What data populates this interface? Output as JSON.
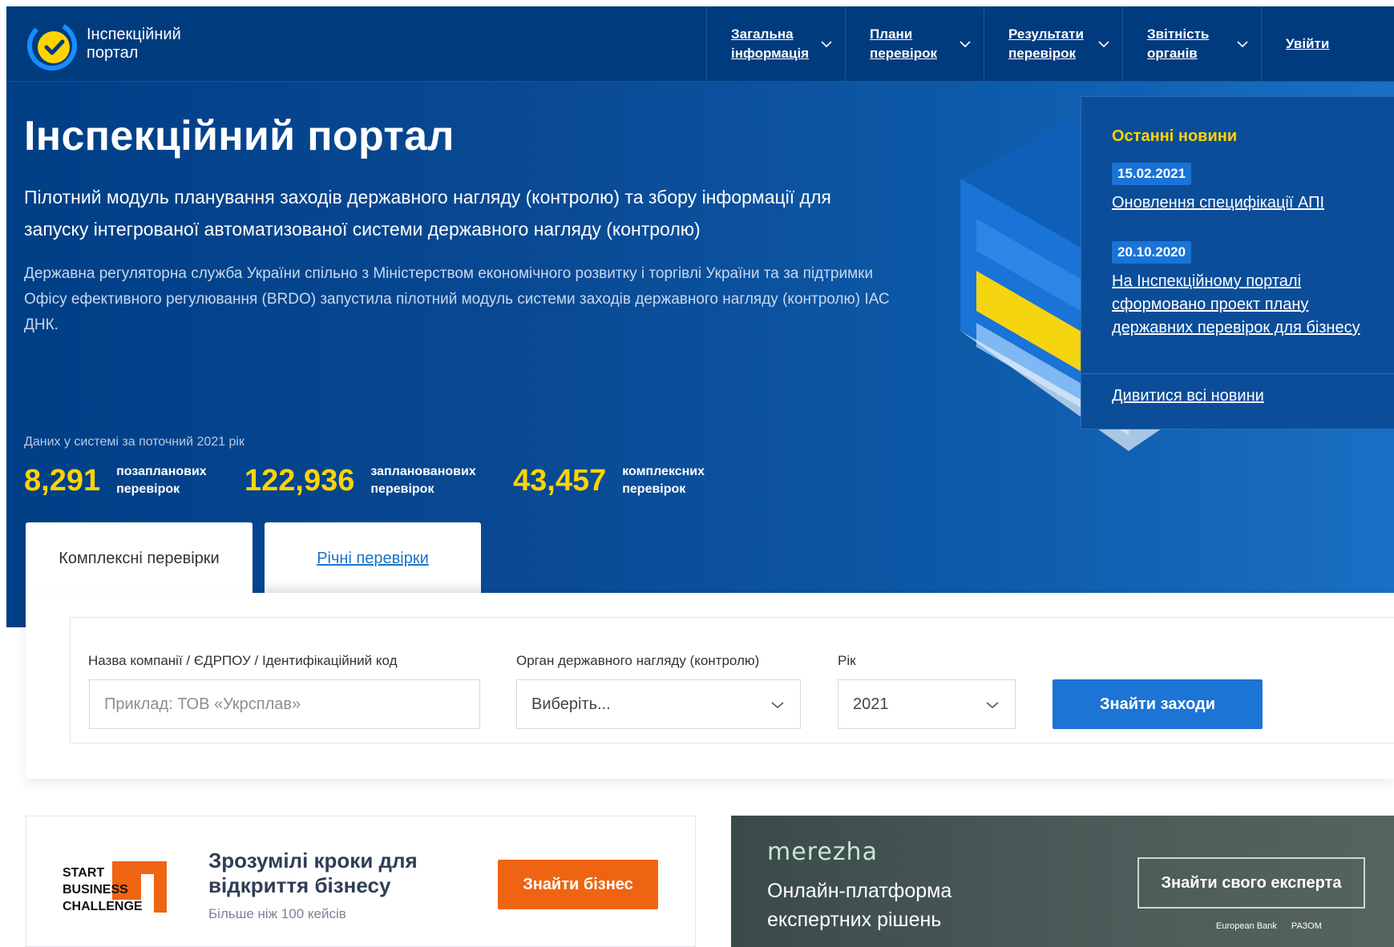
{
  "header": {
    "logo_line1": "Інспекційний",
    "logo_line2": "портал",
    "nav": [
      {
        "label": "Загальна інформація"
      },
      {
        "label": "Плани перевірок"
      },
      {
        "label": "Результати перевірок"
      },
      {
        "label": "Звітність органів"
      }
    ],
    "login": "Увійти"
  },
  "hero": {
    "title": "Інспекційний портал",
    "lead": "Пілотний модуль планування заходів державного нагляду (контролю) та збору інформації для запуску інтегрованої автоматизованої системи державного нагляду (контролю)",
    "description": "Державна регуляторна служба України спільно з Міністерством економічного розвитку і торгівлі України та за підтримки Офісу ефективного регулювання (BRDO) запустила пілотний модуль системи заходів державного нагляду (контролю) ІАС ДНК.",
    "stats_label": "Даних у системі за поточний 2021 рік",
    "stats": [
      {
        "value": "8,291",
        "caption_1": "позапланових",
        "caption_2": "перевірок"
      },
      {
        "value": "122,936",
        "caption_1": "запланованових",
        "caption_2": "перевірок"
      },
      {
        "value": "43,457",
        "caption_1": "комплексних",
        "caption_2": "перевірок"
      }
    ]
  },
  "tabs": {
    "active": "Комплексні перевірки",
    "inactive": "Річні перевірки"
  },
  "news": {
    "title": "Останні новини",
    "items": [
      {
        "date": "15.02.2021",
        "text": "Оновлення специфікації АПІ"
      },
      {
        "date": "20.10.2020",
        "text": "На Інспекційному порталі сформовано проект плану державних перевірок для бізнесу"
      }
    ],
    "all_link": "Дивитися всі новини"
  },
  "search": {
    "company_label": "Назва компанії / ЄДРПОУ / Ідентифікаційний код",
    "company_placeholder": "Приклад: ТОВ «Укрсплав»",
    "organ_label": "Орган державного нагляду (контролю)",
    "organ_value": "Виберіть...",
    "year_label": "Рік",
    "year_value": "2021",
    "submit": "Знайти заходи"
  },
  "banner_business": {
    "logo_line1": "START",
    "logo_line2": "BUSINESS",
    "logo_line3": "CHALLENGE",
    "title": "Зрозумілі кроки для відкриття бізнесу",
    "subtitle": "Більше ніж 100 кейсів",
    "button": "Знайти бізнес"
  },
  "banner_merezha": {
    "brand": "merezha",
    "text": "Онлайн-платформа експертних рішень",
    "button": "Знайти свого експерта",
    "partner_1": "European Bank",
    "partner_2": "РАЗОМ"
  },
  "colors": {
    "primary_blue": "#003b7e",
    "accent_yellow": "#ffd400",
    "button_blue": "#1c74d4",
    "orange": "#ef6413"
  }
}
